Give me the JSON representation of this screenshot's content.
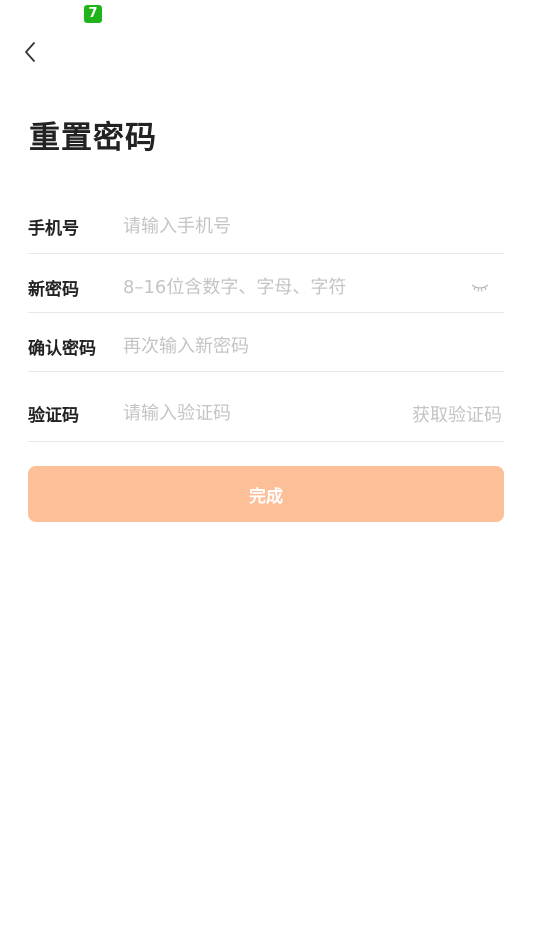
{
  "status_bar": {
    "app_icon_glyph": "7",
    "app_icon_color": "#1fb51a"
  },
  "nav": {
    "back_icon": "chevron-left-icon"
  },
  "page": {
    "title": "重置密码"
  },
  "form": {
    "phone": {
      "label": "手机号",
      "placeholder": "请输入手机号",
      "value": ""
    },
    "new_password": {
      "label": "新密码",
      "placeholder": "8–16位含数字、字母、字符",
      "value": "",
      "toggle_icon": "eye-closed-icon"
    },
    "confirm_password": {
      "label": "确认密码",
      "placeholder": "再次输入新密码",
      "value": ""
    },
    "verification_code": {
      "label": "验证码",
      "placeholder": "请输入验证码",
      "value": "",
      "get_code_label": "获取验证码"
    }
  },
  "actions": {
    "submit_label": "完成",
    "submit_color": "#fdbf98"
  }
}
